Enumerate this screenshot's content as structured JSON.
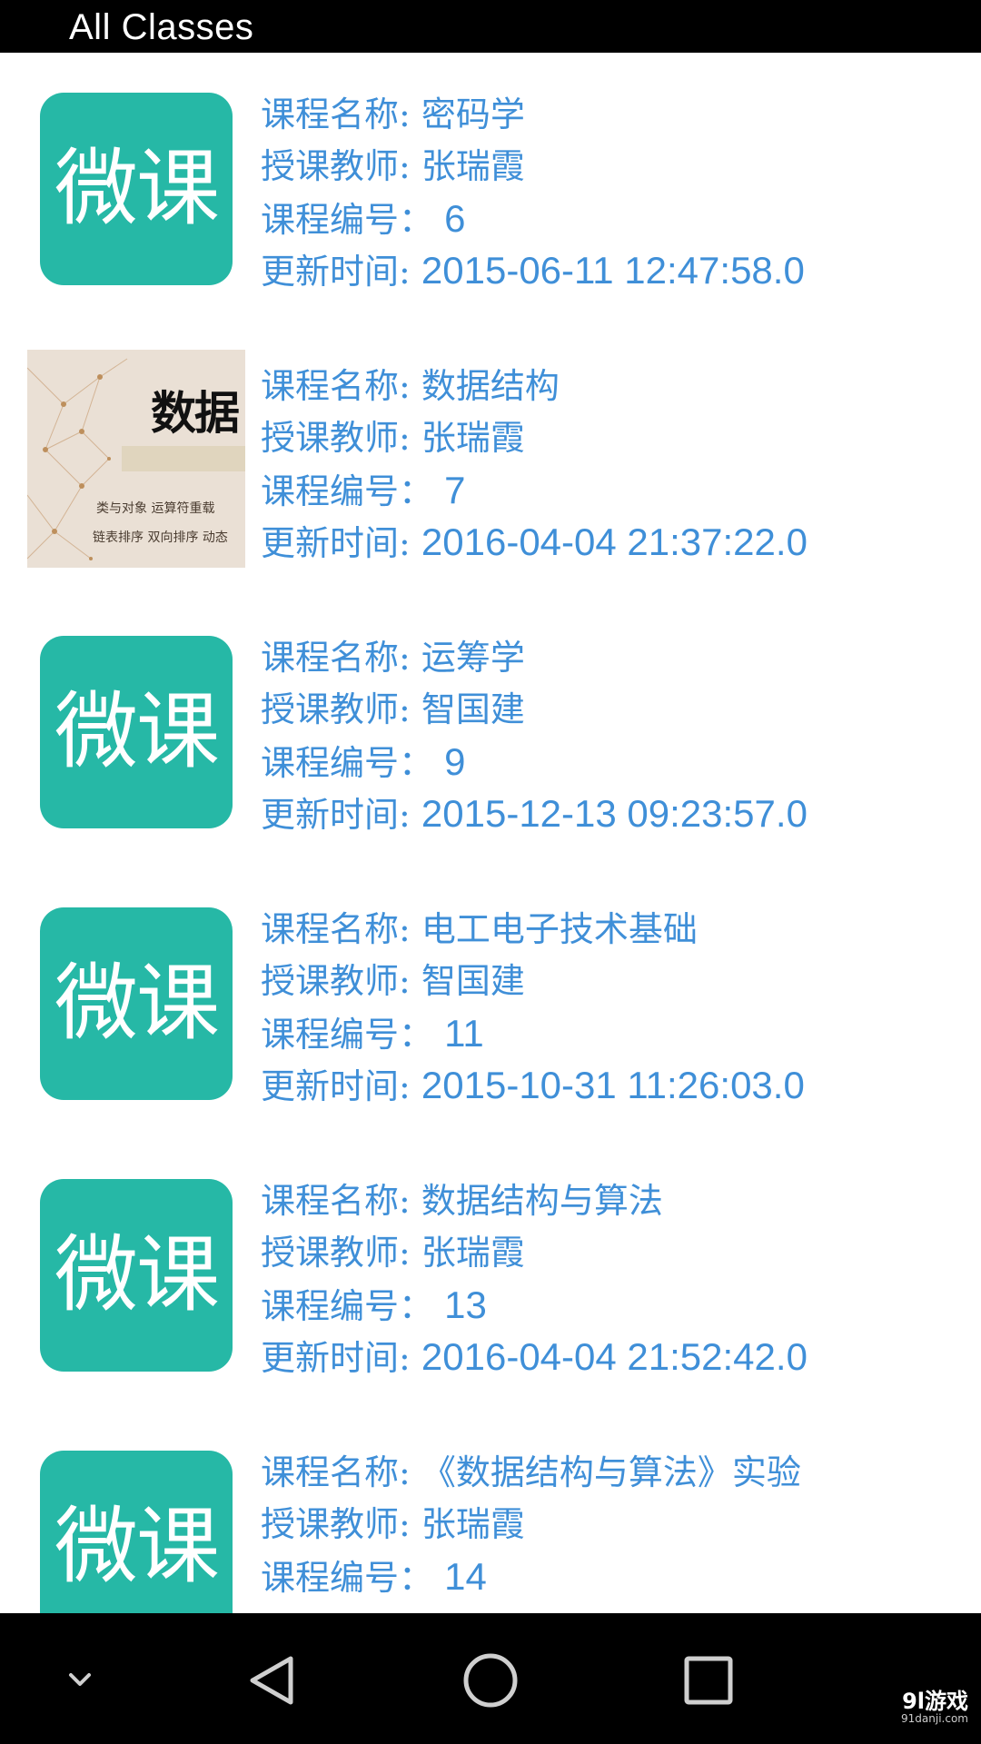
{
  "app_bar": {
    "title": "All Classes"
  },
  "courses": [
    {
      "thumb_text": "微课",
      "name_label": "课程名称:",
      "name": "密码学",
      "teacher_label": "授课教师:",
      "teacher": "张瑞霞",
      "id_label": "课程编号：",
      "id": "6",
      "updated_label": "更新时间:",
      "updated": "2015-06-11 12:47:58.0"
    },
    {
      "thumb_text": "数据",
      "thumb_line1": "类与对象 运算符重载",
      "thumb_line2": "链表排序 双向排序 动态",
      "name_label": "课程名称:",
      "name": "数据结构",
      "teacher_label": "授课教师:",
      "teacher": "张瑞霞",
      "id_label": "课程编号：",
      "id": "7",
      "updated_label": "更新时间:",
      "updated": "2016-04-04 21:37:22.0"
    },
    {
      "thumb_text": "微课",
      "name_label": "课程名称:",
      "name": "运筹学",
      "teacher_label": "授课教师:",
      "teacher": "智国建",
      "id_label": "课程编号：",
      "id": "9",
      "updated_label": "更新时间:",
      "updated": "2015-12-13 09:23:57.0"
    },
    {
      "thumb_text": "微课",
      "name_label": "课程名称:",
      "name": "电工电子技术基础",
      "teacher_label": "授课教师:",
      "teacher": "智国建",
      "id_label": "课程编号：",
      "id": "11",
      "updated_label": "更新时间:",
      "updated": "2015-10-31 11:26:03.0"
    },
    {
      "thumb_text": "微课",
      "name_label": "课程名称:",
      "name": "数据结构与算法",
      "teacher_label": "授课教师:",
      "teacher": "张瑞霞",
      "id_label": "课程编号：",
      "id": "13",
      "updated_label": "更新时间:",
      "updated": "2016-04-04 21:52:42.0"
    },
    {
      "thumb_text": "微课",
      "name_label": "课程名称:",
      "name": "《数据结构与算法》实验",
      "teacher_label": "授课教师:",
      "teacher": "张瑞霞",
      "id_label": "课程编号：",
      "id": "14"
    }
  ],
  "nav_bar": {
    "icons": [
      "chevron-down-icon",
      "back-icon",
      "home-icon",
      "recents-icon"
    ]
  },
  "watermark": {
    "brand": "9l游戏",
    "url": "91danji.com"
  },
  "colors": {
    "accent_text": "#3f8fd8",
    "thumb_bg": "#26b8a6",
    "bars": "#000000"
  }
}
